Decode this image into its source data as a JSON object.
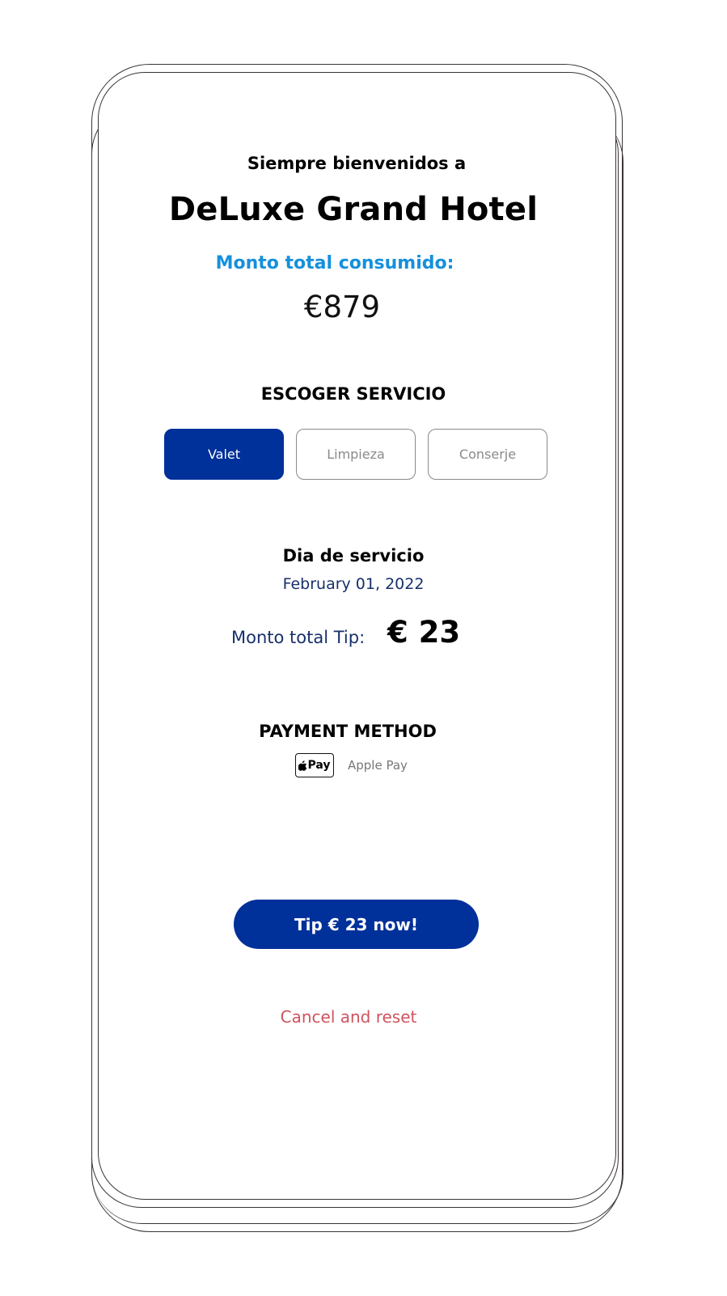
{
  "header": {
    "welcome": "Siempre bienvenidos a",
    "hotel_name": "DeLuxe Grand Hotel"
  },
  "consumption": {
    "label": "Monto total consumido:",
    "value": "€879"
  },
  "services": {
    "heading": "ESCOGER SERVICIO",
    "options": [
      {
        "label": "Valet",
        "selected": true
      },
      {
        "label": "Limpieza",
        "selected": false
      },
      {
        "label": "Conserje",
        "selected": false
      }
    ]
  },
  "service_day": {
    "heading": "Dia de servicio",
    "date": "February 01, 2022"
  },
  "tip": {
    "label": "Monto total Tip:",
    "value": "€ 23"
  },
  "payment": {
    "heading": "PAYMENT METHOD",
    "badge_text": "Pay",
    "method": "Apple Pay"
  },
  "actions": {
    "tip_button": "Tip € 23 now!",
    "cancel": "Cancel and reset"
  },
  "colors": {
    "primary": "#00309a",
    "accent_blue": "#1590dc",
    "navy_text": "#17306b",
    "cancel_red": "#d0535e"
  },
  "icons": {
    "payment_badge": "apple-logo-icon"
  }
}
